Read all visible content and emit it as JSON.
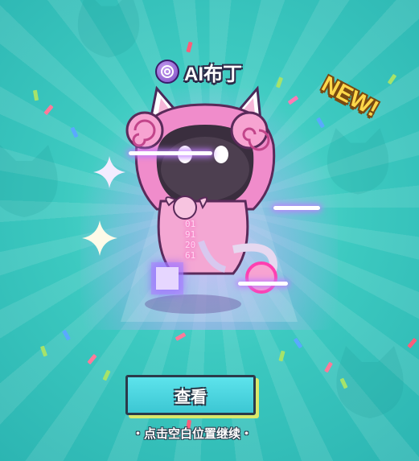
{
  "reward": {
    "character_name": "AI布丁",
    "badge_icon": "spiral-badge-icon",
    "new_label": "NEW!",
    "glitch_text": "01912061"
  },
  "actions": {
    "view_label": "查看",
    "continue_hint": "・点击空白位置继续・"
  },
  "colors": {
    "background": "#3cc9c0",
    "button": "#4fd6e0",
    "button_shadow": "#d9e86a",
    "new_badge": "#ffd84a",
    "character_pink": "#f08ccb",
    "glow_purple": "#c07dff"
  }
}
